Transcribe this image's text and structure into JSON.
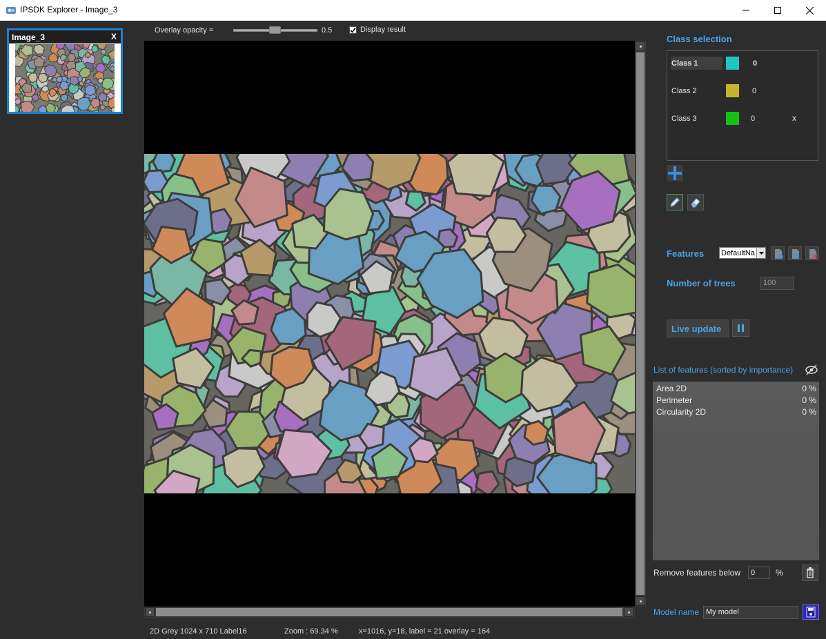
{
  "window": {
    "title": "IPSDK Explorer - Image_3",
    "controls": {
      "minimize": "—",
      "maximize": "☐",
      "close": "✕"
    }
  },
  "thumbnail": {
    "name": "Image_3",
    "close_label": "X"
  },
  "toolbar": {
    "overlay_label": "Overlay opacity =",
    "overlay_value": "0.5",
    "display_result_label": "Display result",
    "display_result_checked": true
  },
  "classes": {
    "header": "Class selection",
    "items": [
      {
        "name": "Class 1",
        "color": "#1fc6c0",
        "count": "0"
      },
      {
        "name": "Class 2",
        "color": "#c8b42a",
        "count": "0"
      },
      {
        "name": "Class 3",
        "color": "#13c213",
        "count": "0",
        "remove": "x"
      }
    ]
  },
  "features": {
    "header": "Features",
    "preset": "DefaultNa",
    "trees_header": "Number of trees",
    "trees_value": "100",
    "live_update_label": "Live update",
    "list_header": "List of features (sorted by importance)",
    "list": [
      {
        "name": "Area 2D",
        "value": "0 %"
      },
      {
        "name": "Perimeter",
        "value": "0 %"
      },
      {
        "name": "Circularity 2D",
        "value": "0 %"
      }
    ],
    "remove_label": "Remove features below",
    "remove_value": "0",
    "remove_unit": "%",
    "model_label": "Model name",
    "model_value": "My model"
  },
  "status": {
    "image_info": "2D Grey 1024 x 710 Label16",
    "zoom": "Zoom : 69.34 %",
    "cursor": "x=1016, y=18, label = 21 overlay = 164"
  }
}
